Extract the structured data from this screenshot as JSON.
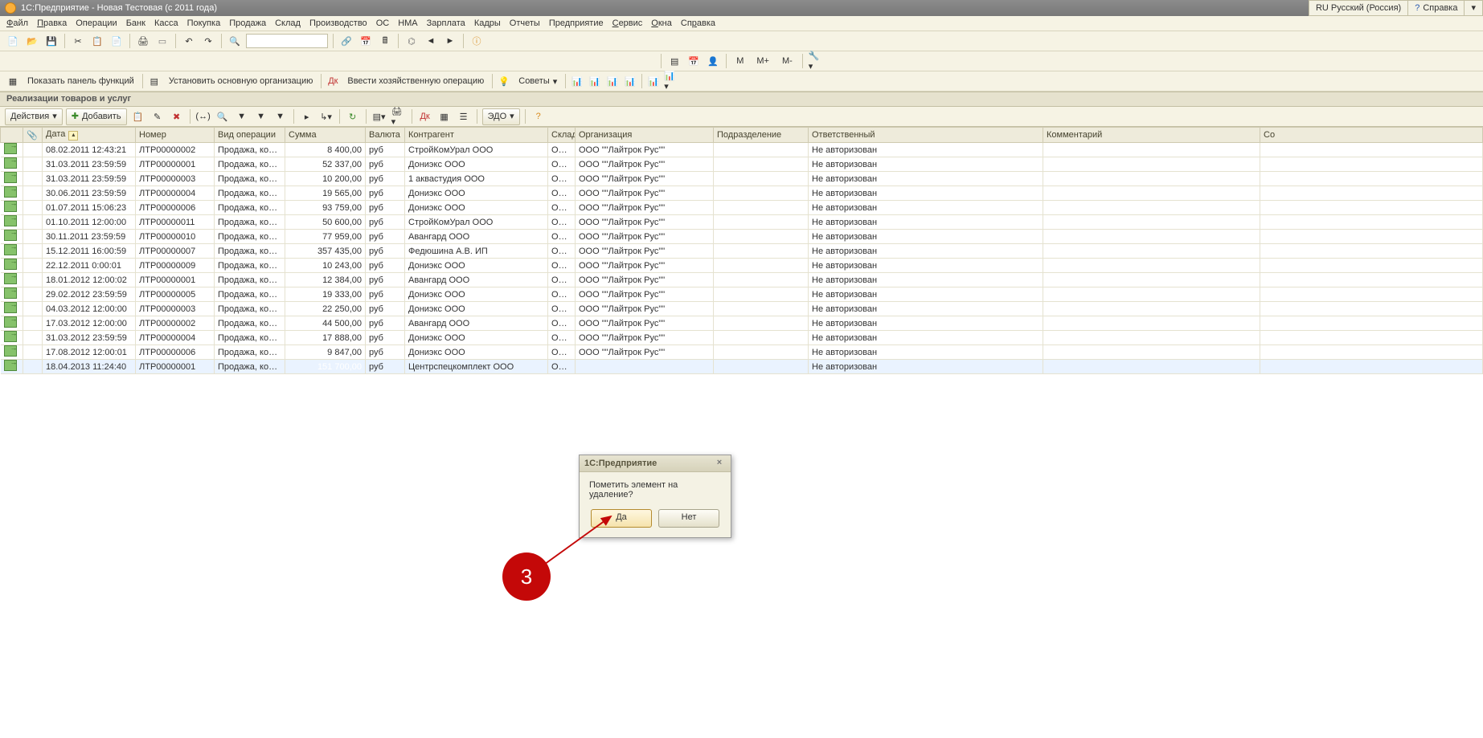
{
  "app_title": "1С:Предприятие - Новая Тестовая (с 2011 года)",
  "lang_indicator": "RU Русский (Россия)",
  "help_label": "Справка",
  "menu": [
    "Файл",
    "Правка",
    "Операции",
    "Банк",
    "Касса",
    "Покупка",
    "Продажа",
    "Склад",
    "Производство",
    "ОС",
    "НМА",
    "Зарплата",
    "Кадры",
    "Отчеты",
    "Предприятие",
    "Сервис",
    "Окна",
    "Справка"
  ],
  "tb3": {
    "show_panel": "Показать панель функций",
    "set_org": "Установить основную организацию",
    "enter_op": "Ввести хозяйственную операцию",
    "advice": "Советы"
  },
  "tb2_labels": {
    "m": "M",
    "mplus": "M+",
    "mminus": "M-"
  },
  "group_title": "Реализации товаров и услуг",
  "actions": {
    "actions": "Действия",
    "add": "Добавить",
    "edo": "ЭДО"
  },
  "columns": [
    "",
    "Дата",
    "Номер",
    "Вид операции",
    "Сумма",
    "Валюта",
    "Контрагент",
    "Склад",
    "Организация",
    "Подразделение",
    "Ответственный",
    "Комментарий",
    "Со"
  ],
  "rows": [
    {
      "date": "08.02.2011 12:43:21",
      "num": "ЛТР00000002",
      "op": "Продажа, комис...",
      "sum": "8 400,00",
      "cur": "руб",
      "kont": "СтройКомУрал ООО",
      "skl": "Осн...",
      "org": "ООО \"\"Лайтрок Рус\"\"",
      "resp": "Не авторизован"
    },
    {
      "date": "31.03.2011 23:59:59",
      "num": "ЛТР00000001",
      "op": "Продажа, комис...",
      "sum": "52 337,00",
      "cur": "руб",
      "kont": "Дониэкс ООО",
      "skl": "Осн...",
      "org": "ООО \"\"Лайтрок Рус\"\"",
      "resp": "Не авторизован"
    },
    {
      "date": "31.03.2011 23:59:59",
      "num": "ЛТР00000003",
      "op": "Продажа, комис...",
      "sum": "10 200,00",
      "cur": "руб",
      "kont": "1 аквастудия ООО",
      "skl": "Осн...",
      "org": "ООО \"\"Лайтрок Рус\"\"",
      "resp": "Не авторизован"
    },
    {
      "date": "30.06.2011 23:59:59",
      "num": "ЛТР00000004",
      "op": "Продажа, комис...",
      "sum": "19 565,00",
      "cur": "руб",
      "kont": "Дониэкс ООО",
      "skl": "Осн...",
      "org": "ООО \"\"Лайтрок Рус\"\"",
      "resp": "Не авторизован"
    },
    {
      "date": "01.07.2011 15:06:23",
      "num": "ЛТР00000006",
      "op": "Продажа, комис...",
      "sum": "93 759,00",
      "cur": "руб",
      "kont": "Дониэкс ООО",
      "skl": "Осн...",
      "org": "ООО \"\"Лайтрок Рус\"\"",
      "resp": "Не авторизован"
    },
    {
      "date": "01.10.2011 12:00:00",
      "num": "ЛТР00000011",
      "op": "Продажа, комис...",
      "sum": "50 600,00",
      "cur": "руб",
      "kont": "СтройКомУрал ООО",
      "skl": "Осн...",
      "org": "ООО \"\"Лайтрок Рус\"\"",
      "resp": "Не авторизован"
    },
    {
      "date": "30.11.2011 23:59:59",
      "num": "ЛТР00000010",
      "op": "Продажа, комис...",
      "sum": "77 959,00",
      "cur": "руб",
      "kont": "Авангард ООО",
      "skl": "Осн...",
      "org": "ООО \"\"Лайтрок Рус\"\"",
      "resp": "Не авторизован"
    },
    {
      "date": "15.12.2011 16:00:59",
      "num": "ЛТР00000007",
      "op": "Продажа, комис...",
      "sum": "357 435,00",
      "cur": "руб",
      "kont": "Федюшина А.В. ИП",
      "skl": "Осн...",
      "org": "ООО \"\"Лайтрок Рус\"\"",
      "resp": "Не авторизован"
    },
    {
      "date": "22.12.2011 0:00:01",
      "num": "ЛТР00000009",
      "op": "Продажа, комис...",
      "sum": "10 243,00",
      "cur": "руб",
      "kont": "Дониэкс ООО",
      "skl": "Осн...",
      "org": "ООО \"\"Лайтрок Рус\"\"",
      "resp": "Не авторизован"
    },
    {
      "date": "18.01.2012 12:00:02",
      "num": "ЛТР00000001",
      "op": "Продажа, комис...",
      "sum": "12 384,00",
      "cur": "руб",
      "kont": "Авангард ООО",
      "skl": "Осн...",
      "org": "ООО \"\"Лайтрок Рус\"\"",
      "resp": "Не авторизован"
    },
    {
      "date": "29.02.2012 23:59:59",
      "num": "ЛТР00000005",
      "op": "Продажа, комис...",
      "sum": "19 333,00",
      "cur": "руб",
      "kont": "Дониэкс ООО",
      "skl": "Осн...",
      "org": "ООО \"\"Лайтрок Рус\"\"",
      "resp": "Не авторизован"
    },
    {
      "date": "04.03.2012 12:00:00",
      "num": "ЛТР00000003",
      "op": "Продажа, комис...",
      "sum": "22 250,00",
      "cur": "руб",
      "kont": "Дониэкс ООО",
      "skl": "Осн...",
      "org": "ООО \"\"Лайтрок Рус\"\"",
      "resp": "Не авторизован"
    },
    {
      "date": "17.03.2012 12:00:00",
      "num": "ЛТР00000002",
      "op": "Продажа, комис...",
      "sum": "44 500,00",
      "cur": "руб",
      "kont": "Авангард ООО",
      "skl": "Осн...",
      "org": "ООО \"\"Лайтрок Рус\"\"",
      "resp": "Не авторизован"
    },
    {
      "date": "31.03.2012 23:59:59",
      "num": "ЛТР00000004",
      "op": "Продажа, комис...",
      "sum": "17 888,00",
      "cur": "руб",
      "kont": "Дониэкс ООО",
      "skl": "Осн...",
      "org": "ООО \"\"Лайтрок Рус\"\"",
      "resp": "Не авторизован"
    },
    {
      "date": "17.08.2012 12:00:01",
      "num": "ЛТР00000006",
      "op": "Продажа, комис...",
      "sum": "9 847,00",
      "cur": "руб",
      "kont": "Дониэкс ООО",
      "skl": "Осн...",
      "org": "ООО \"\"Лайтрок Рус\"\"",
      "resp": "Не авторизован"
    },
    {
      "date": "18.04.2013 11:24:40",
      "num": "ЛТР00000001",
      "op": "Продажа, комис...",
      "sum": "151 700,00",
      "cur": "руб",
      "kont": "Центрспецкомплект ООО",
      "skl": "Осн...",
      "org": "",
      "resp": "Не авторизован",
      "selected": true
    }
  ],
  "dialog": {
    "title": "1С:Предприятие",
    "message": "Пометить элемент на удаление?",
    "yes": "Да",
    "no": "Нет"
  },
  "annotation": "3"
}
